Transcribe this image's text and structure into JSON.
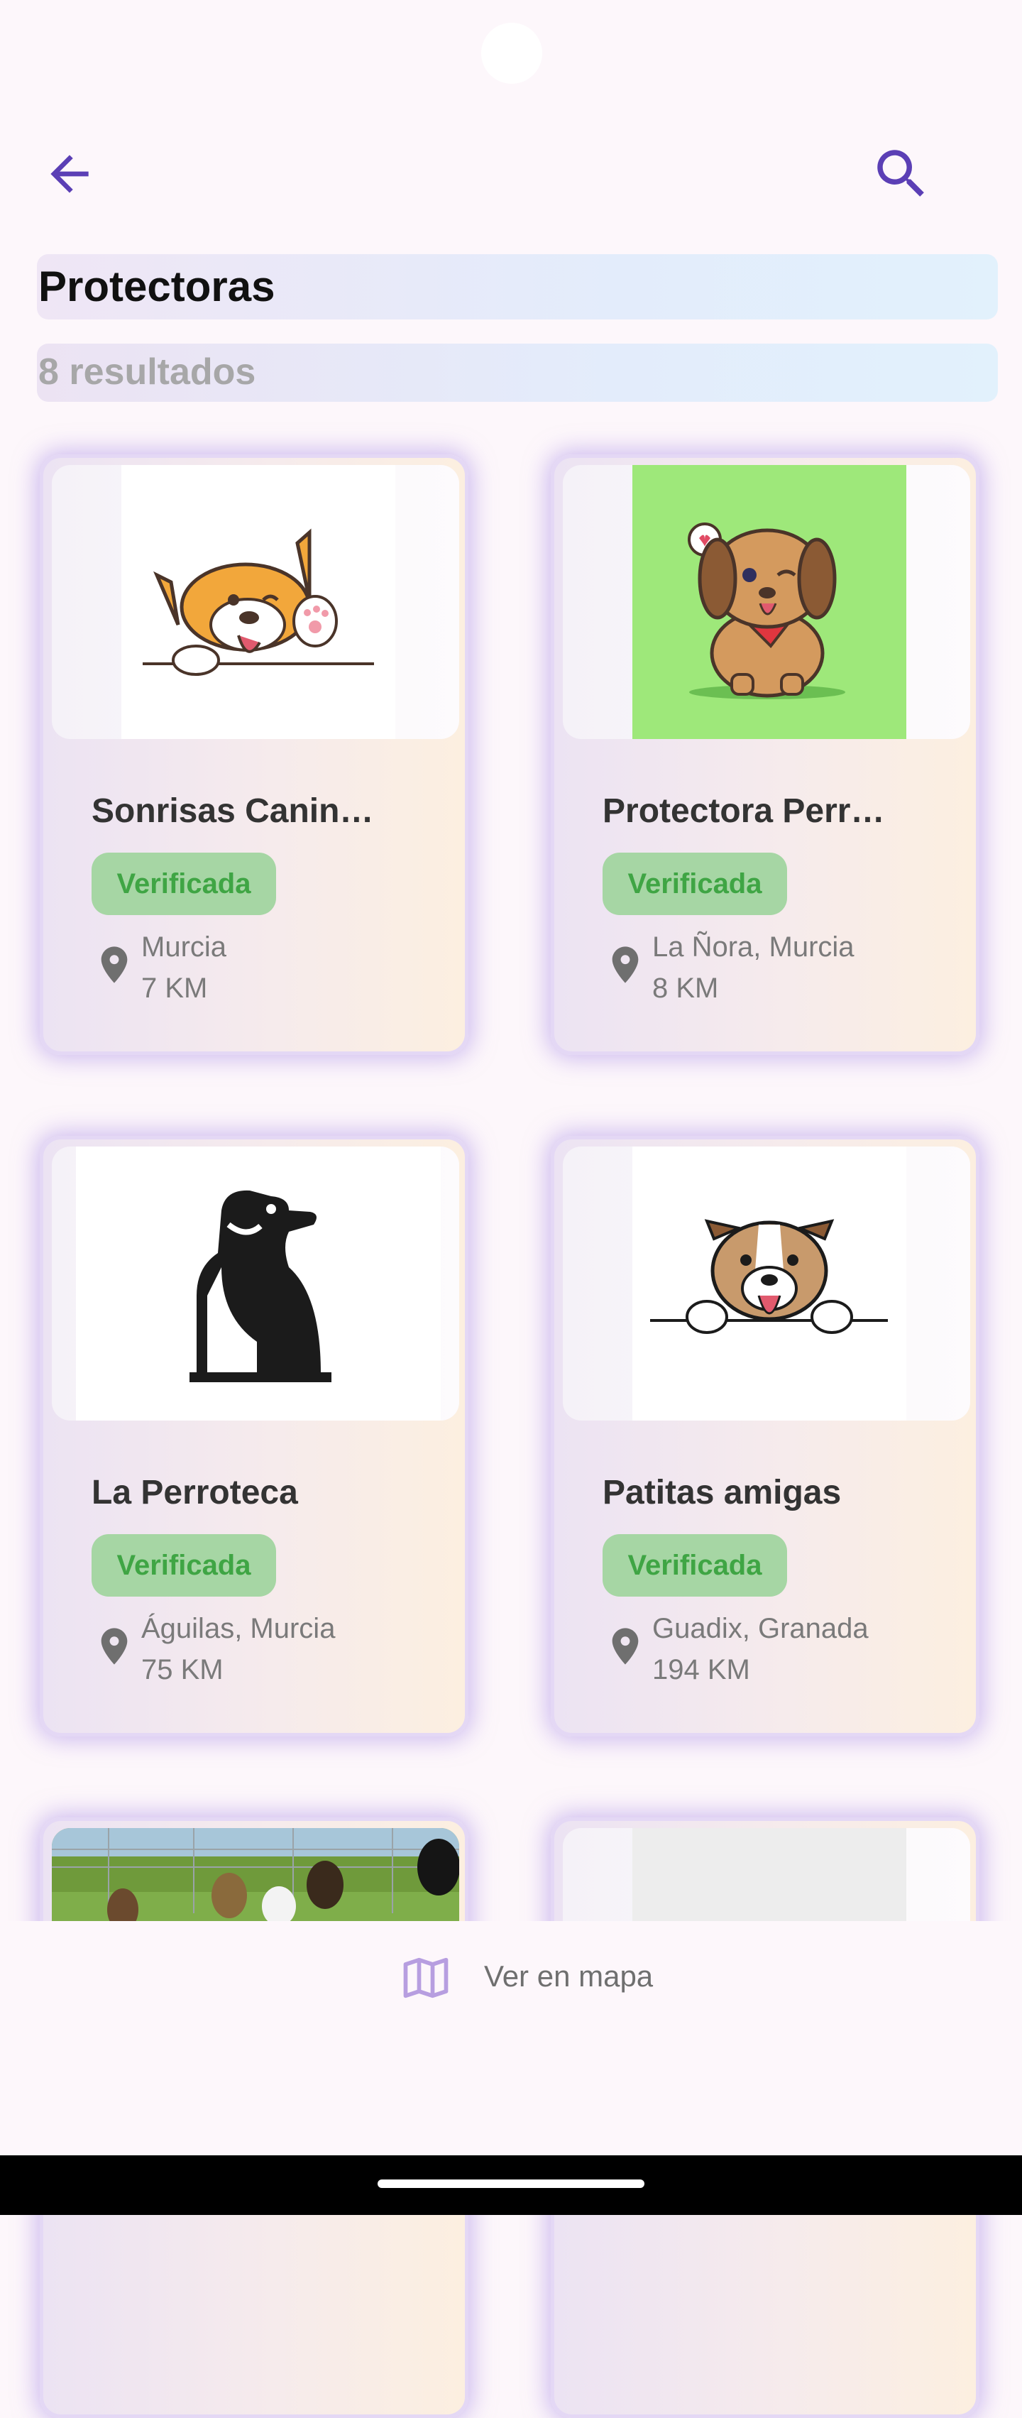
{
  "header": {
    "title": "Protectoras",
    "result_count": "8 resultados"
  },
  "cards": [
    {
      "name": "Sonrisas Canin…",
      "badge": "Verificada",
      "city": "Murcia",
      "distance": "7 KM"
    },
    {
      "name": "Protectora Perr…",
      "badge": "Verificada",
      "city": "La Ñora, Murcia",
      "distance": "8 KM"
    },
    {
      "name": "La Perroteca",
      "badge": "Verificada",
      "city": "Águilas, Murcia",
      "distance": "75 KM"
    },
    {
      "name": "Patitas amigas",
      "badge": "Verificada",
      "city": "Guadix, Granada",
      "distance": "194 KM"
    }
  ],
  "bottom": {
    "map_label": "Ver en mapa"
  },
  "icons": {
    "back": "arrow-back-icon",
    "search": "search-icon",
    "pin": "location-pin-icon",
    "map": "map-icon"
  },
  "colors": {
    "accent": "#5b3fb5",
    "badge_bg": "#a6d6a4",
    "badge_text": "#3fa544",
    "map_icon": "#b79ee0"
  }
}
